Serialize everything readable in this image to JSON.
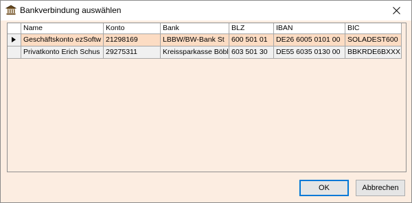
{
  "window": {
    "title": "Bankverbindung auswählen",
    "icon": "bank-icon"
  },
  "grid": {
    "columns": [
      "Name",
      "Konto",
      "Bank",
      "BLZ",
      "IBAN",
      "BIC"
    ],
    "rows": [
      {
        "selected": true,
        "cells": [
          "Geschäftskonto ezSoftw",
          "21298169",
          "LBBW/BW-Bank St",
          "600 501 01",
          "DE26 6005 0101 00",
          "SOLADEST600"
        ]
      },
      {
        "selected": false,
        "cells": [
          "Privatkonto Erich Schus",
          "29275311",
          "Kreissparkasse Böbl",
          "603 501 30",
          "DE55 6035 0130 00",
          "BBKRDE6BXXX"
        ]
      }
    ]
  },
  "buttons": {
    "ok": "OK",
    "cancel": "Abbrechen"
  },
  "colors": {
    "window_bg": "#fcede1",
    "selected_row": "#fcdcc3",
    "accent": "#0078d7"
  }
}
